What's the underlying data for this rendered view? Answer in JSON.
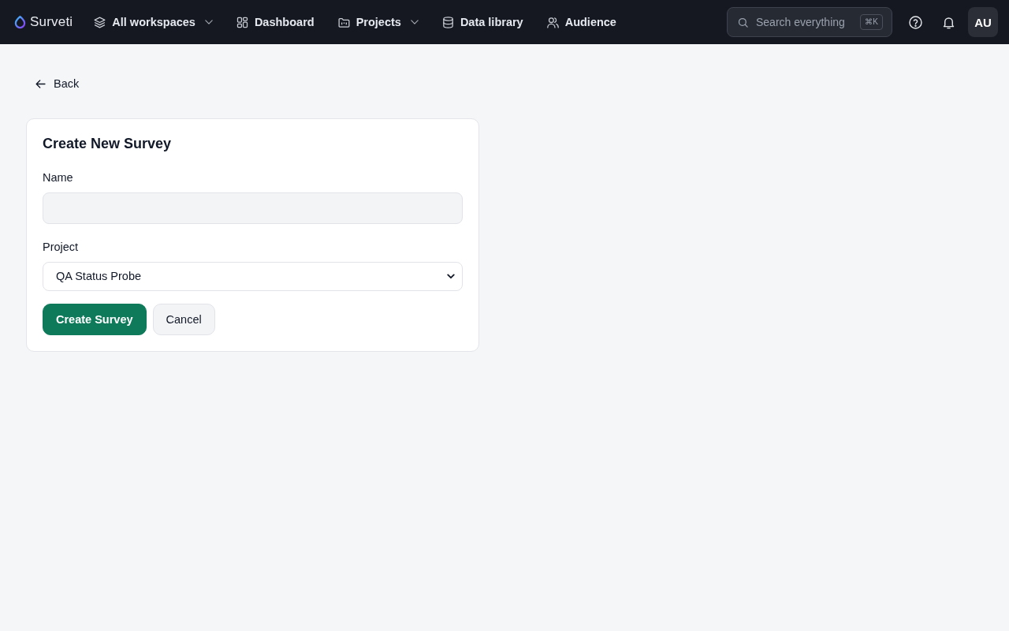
{
  "topbar": {
    "logo": "Surveti",
    "nav": [
      {
        "label": "All workspaces",
        "dropdown": true
      },
      {
        "label": "Dashboard",
        "dropdown": false
      },
      {
        "label": "Projects",
        "dropdown": true
      },
      {
        "label": "Data library",
        "dropdown": false
      },
      {
        "label": "Audience",
        "dropdown": false
      }
    ],
    "search": {
      "placeholder": "Search everything",
      "shortcut": "⌘K"
    },
    "avatar": "AU"
  },
  "back_link": "Back",
  "form": {
    "title": "Create New Survey",
    "fields": [
      {
        "kind": "text",
        "label": "Name"
      },
      {
        "kind": "select",
        "label": "Project",
        "value": "QA Status Probe"
      }
    ],
    "buttons": [
      {
        "kind": "primary",
        "label": "Create Survey"
      },
      {
        "kind": "secondary",
        "label": "Cancel"
      }
    ]
  }
}
